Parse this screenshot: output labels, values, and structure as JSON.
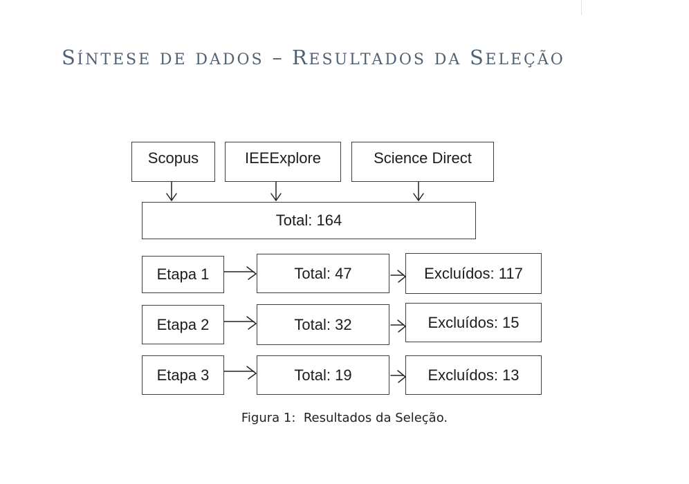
{
  "page": {
    "title_words": [
      {
        "initial": "S",
        "rest": "ÍNTESE"
      },
      {
        "initial": "",
        "rest": "DE"
      },
      {
        "initial": "",
        "rest": "DADOS"
      },
      {
        "initial": "–",
        "rest": ""
      },
      {
        "initial": "R",
        "rest": "ESULTADOS"
      },
      {
        "initial": "",
        "rest": "DA"
      },
      {
        "initial": "S",
        "rest": "ELEÇÃO"
      }
    ],
    "title_color": "#4f6274"
  },
  "diagram": {
    "sources": [
      "Scopus",
      "IEEExplore",
      "Science Direct"
    ],
    "total": "Total: 164",
    "stages": [
      {
        "label": "Etapa 1",
        "total": "Total: 47",
        "excluded": "Excluídos: 117"
      },
      {
        "label": "Etapa 2",
        "total": "Total: 32",
        "excluded": "Excluídos: 15"
      },
      {
        "label": "Etapa 3",
        "total": "Total: 19",
        "excluded": "Excluídos: 13"
      }
    ]
  },
  "caption": "Figura 1:  Resultados da Seleção."
}
